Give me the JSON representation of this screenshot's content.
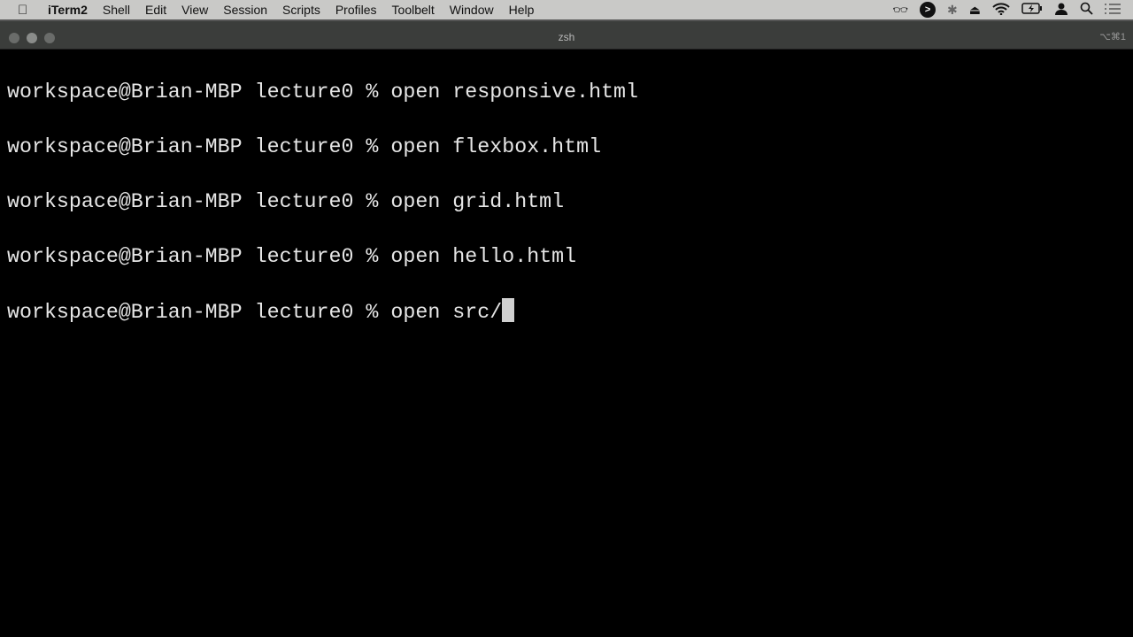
{
  "menubar": {
    "app": "iTerm2",
    "items": [
      "Shell",
      "Edit",
      "View",
      "Session",
      "Scripts",
      "Profiles",
      "Toolbelt",
      "Window",
      "Help"
    ],
    "status_icons": [
      "glasses-icon",
      "arrow-circle-icon",
      "bluetooth-icon",
      "eject-icon",
      "wifi-icon",
      "battery-charging-icon",
      "user-icon",
      "search-icon",
      "menu-list-icon"
    ]
  },
  "window": {
    "title": "zsh",
    "shortcut": "⌥⌘1"
  },
  "terminal": {
    "prompt": "workspace@Brian-MBP lecture0 % ",
    "lines": [
      "open responsive.html",
      "open flexbox.html",
      "open grid.html",
      "open hello.html"
    ],
    "current_input": "open src/"
  }
}
